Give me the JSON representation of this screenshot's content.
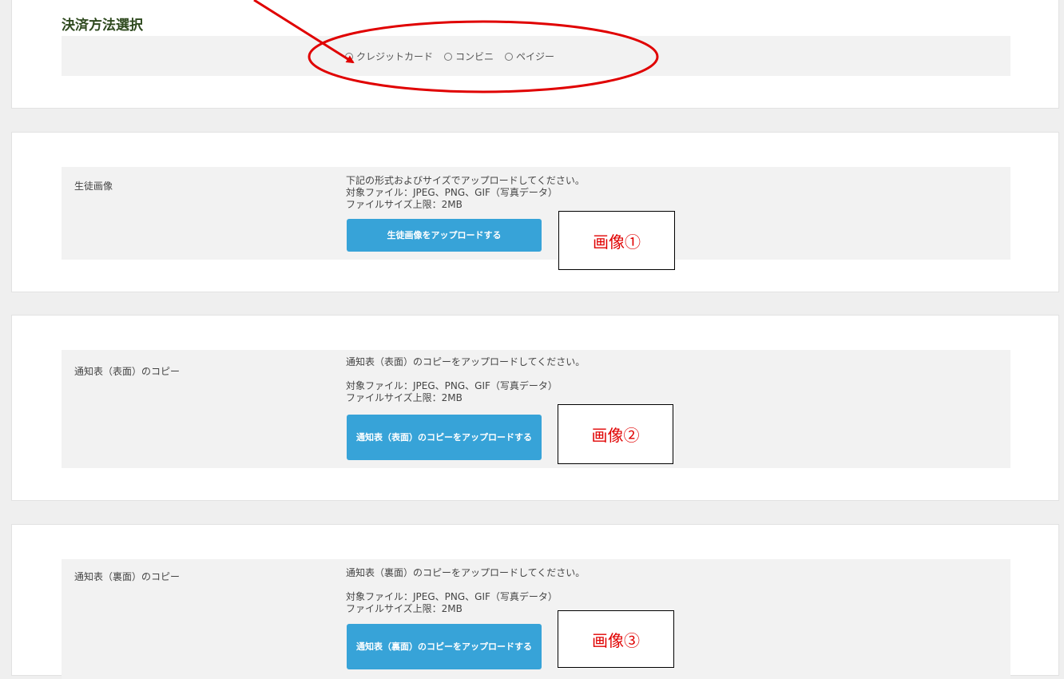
{
  "payment": {
    "title": "決済方法選択",
    "options": [
      "クレジットカード",
      "コンビニ",
      "ペイジー"
    ]
  },
  "uploads": [
    {
      "label": "生徒画像",
      "lines": [
        "下記の形式およびサイズでアップロードしてください。",
        "対象ファイル：JPEG、PNG、GIF（写真データ）",
        "ファイルサイズ上限：2MB"
      ],
      "button": "生徒画像をアップロードする"
    },
    {
      "label": "通知表（表面）のコピー",
      "lines": [
        "通知表（表面）のコピーをアップロードしてください。",
        "対象ファイル：JPEG、PNG、GIF（写真データ）",
        "ファイルサイズ上限：2MB"
      ],
      "button": "通知表（表面）のコピーをアップロードする"
    },
    {
      "label": "通知表（裏面）のコピー",
      "lines": [
        "通知表（裏面）のコピーをアップロードしてください。",
        "対象ファイル：JPEG、PNG、GIF（写真データ）",
        "ファイルサイズ上限：2MB"
      ],
      "button": "通知表（裏面）のコピーをアップロードする"
    }
  ],
  "annotations": {
    "labels": [
      "画像①",
      "画像②",
      "画像③"
    ],
    "color": "#e00000"
  }
}
